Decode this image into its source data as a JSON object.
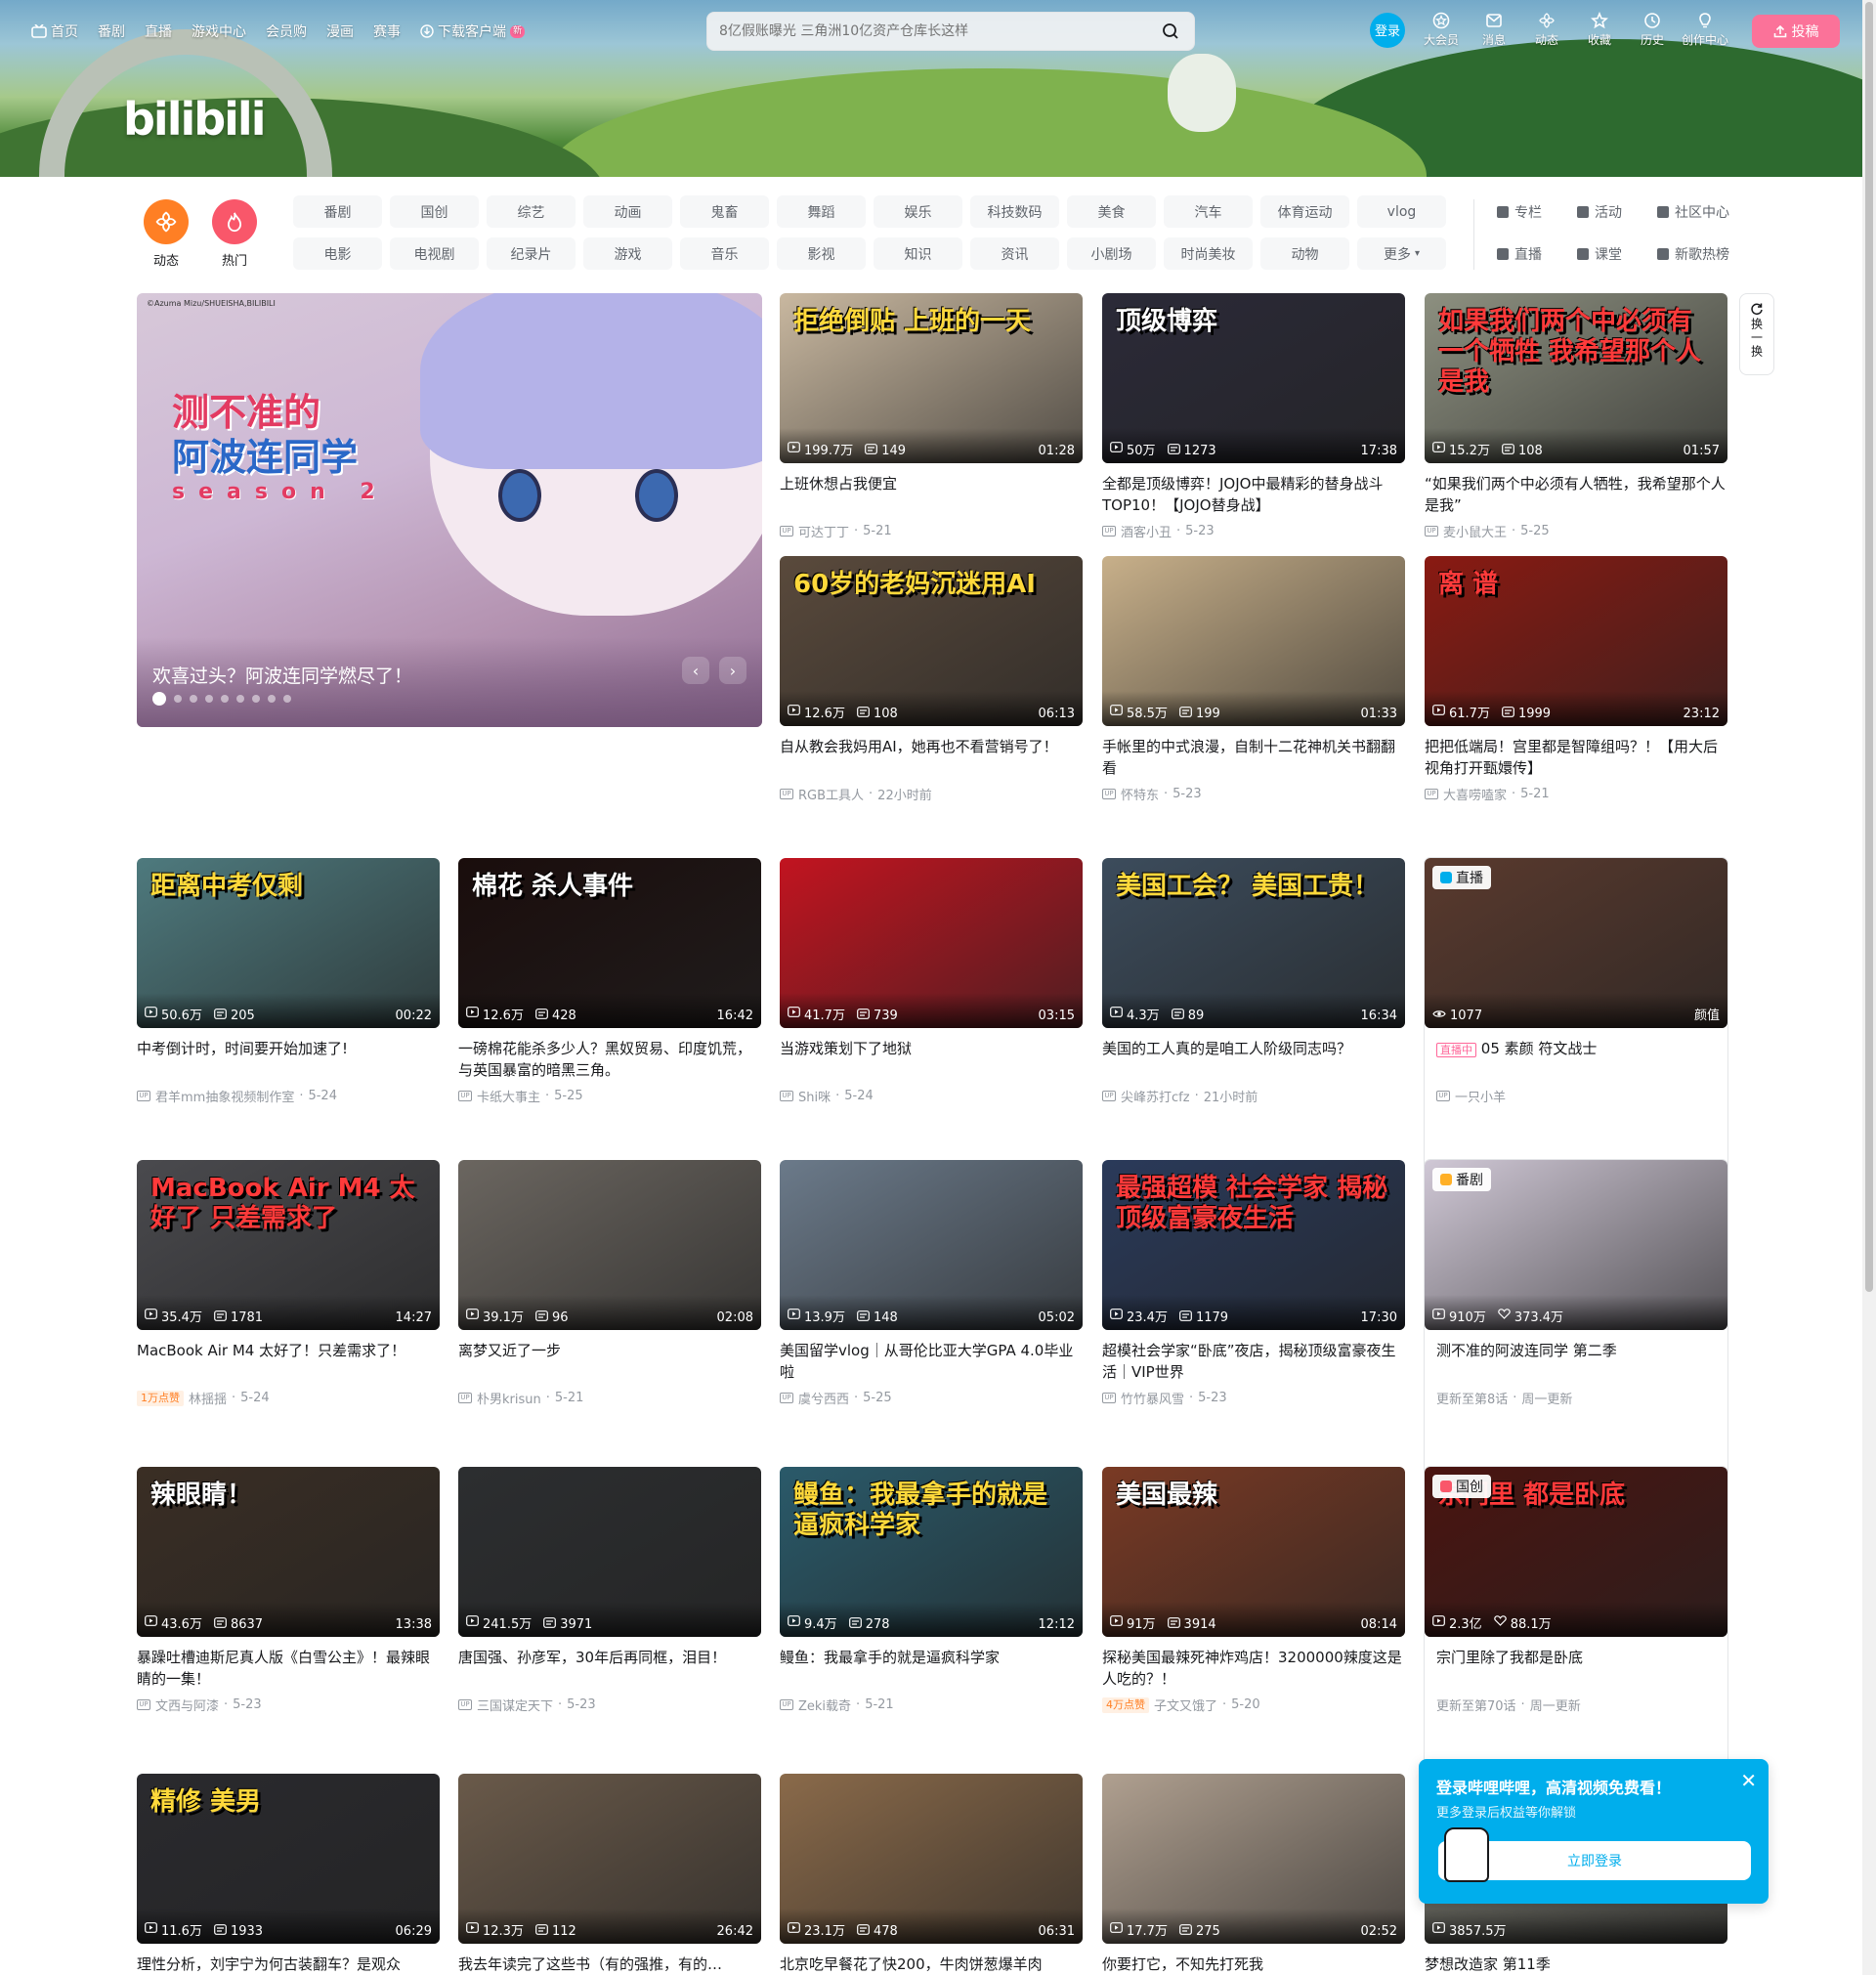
{
  "header": {
    "logo_text": "bilibili",
    "nav": [
      {
        "label": "首页",
        "icon": "tv-icon"
      },
      {
        "label": "番剧"
      },
      {
        "label": "直播"
      },
      {
        "label": "游戏中心"
      },
      {
        "label": "会员购"
      },
      {
        "label": "漫画"
      },
      {
        "label": "赛事"
      },
      {
        "label": "下载客户端",
        "icon": "download-icon",
        "badge": "新"
      }
    ],
    "search_placeholder": "8亿假账曝光 三角洲10亿资产仓库长这样",
    "login_label": "登录",
    "right_entries": [
      {
        "label": "大会员",
        "icon": "vip-icon"
      },
      {
        "label": "消息",
        "icon": "message-icon"
      },
      {
        "label": "动态",
        "icon": "dynamic-icon"
      },
      {
        "label": "收藏",
        "icon": "favorite-icon"
      },
      {
        "label": "历史",
        "icon": "history-icon"
      },
      {
        "label": "创作中心",
        "icon": "creator-icon"
      }
    ],
    "upload_label": "投稿"
  },
  "channels": {
    "big": [
      {
        "label": "动态",
        "color": "#ff7f24"
      },
      {
        "label": "热门",
        "color": "#f9576a"
      }
    ],
    "row1": [
      "番剧",
      "国创",
      "综艺",
      "动画",
      "鬼畜",
      "舞蹈",
      "娱乐",
      "科技数码",
      "美食",
      "汽车",
      "体育运动",
      "vlog"
    ],
    "row2": [
      "电影",
      "电视剧",
      "纪录片",
      "游戏",
      "音乐",
      "影视",
      "知识",
      "资讯",
      "小剧场",
      "时尚美妆",
      "动物",
      "更多"
    ],
    "side": [
      "专栏",
      "活动",
      "社区中心",
      "直播",
      "课堂",
      "新歌热榜"
    ]
  },
  "carousel": {
    "credit": "©Azuma Mizu/SHUEISHA,BILIBILI",
    "art_line1": "测不准的",
    "art_line2": "阿波连同学",
    "art_line3": "season 2",
    "caption": "欢喜过头？阿波连同学燃尽了！",
    "prev": "‹",
    "next": "›",
    "dots_total": 9,
    "dot_active": 1
  },
  "refresh_label": "换一换",
  "cards": [
    {
      "overlay": "拒绝倒贴 上班的一天",
      "views": "199.7万",
      "danmaku": "149",
      "duration": "01:28",
      "title": "上班休想占我便宜",
      "up": "可达丁丁",
      "date": "5-21",
      "bg": "#c9b8a0"
    },
    {
      "overlay": "顶级博弈",
      "views": "50万",
      "danmaku": "1273",
      "duration": "17:38",
      "title": "全都是顶级博弈！JOJO中最精彩的替身战斗TOP10！【JOJO替身战】",
      "up": "酒客小丑",
      "date": "5-23",
      "bg": "#2b2a38"
    },
    {
      "overlay": "如果我们两个中必须有一个牺牲 我希望那个人是我",
      "views": "15.2万",
      "danmaku": "108",
      "duration": "01:57",
      "title": "“如果我们两个中必须有人牺牲，我希望那个人是我”",
      "up": "麦小鼠大王",
      "date": "5-25",
      "bg": "#8d9080"
    },
    {
      "overlay": "60岁的老妈沉迷用AI",
      "views": "12.6万",
      "danmaku": "108",
      "duration": "06:13",
      "title": "自从教会我妈用AI，她再也不看营销号了！",
      "up": "RGB工具人",
      "date": "22小时前",
      "bg": "#5a4a3c"
    },
    {
      "overlay": "",
      "views": "58.5万",
      "danmaku": "199",
      "duration": "01:33",
      "title": "手帐里的中式浪漫，自制十二花神机关书翻翻看",
      "up": "怀特东",
      "date": "5-23",
      "bg": "#c8b08a"
    },
    {
      "overlay": "离 谱",
      "views": "61.7万",
      "danmaku": "1999",
      "duration": "23:12",
      "title": "把把低端局！宫里都是智障组吗？！【用大后视角打开甄嬛传】",
      "up": "大喜唠嗑家",
      "date": "5-21",
      "bg": "#8a1a12"
    },
    {
      "overlay": "距离中考仅剩",
      "views": "50.6万",
      "danmaku": "205",
      "duration": "00:22",
      "title": "中考倒计时，时间要开始加速了!",
      "up": "君羊mm抽象视频制作室",
      "date": "5-24",
      "bg": "#4e7a7e"
    },
    {
      "overlay": "棉花 杀人事件",
      "views": "12.6万",
      "danmaku": "428",
      "duration": "16:42",
      "title": "一磅棉花能杀多少人？黑奴贸易、印度饥荒，与英国暴富的暗黑三角。",
      "up": "卡纸大事主",
      "date": "5-25",
      "bg": "#1a0d0c"
    },
    {
      "overlay": "",
      "views": "41.7万",
      "danmaku": "739",
      "duration": "03:15",
      "title": "当游戏策划下了地狱",
      "up": "Shi咪",
      "date": "5-24",
      "bg": "#c21420"
    },
    {
      "overlay": "美国工会？ 美国工贵！",
      "views": "4.3万",
      "danmaku": "89",
      "duration": "16:34",
      "title": "美国的工人真的是咱工人阶级同志吗？",
      "up": "尖峰苏打cfz",
      "date": "21小时前",
      "bg": "#3c4c5c"
    },
    {
      "overlay": "",
      "tag": "直播",
      "views": "1077",
      "area": "颜值",
      "live_badge": "直播中",
      "title": "05 素颜 符文战士",
      "up": "一只小羊",
      "bg": "#5a3a2e"
    },
    {
      "overlay": "MacBook Air M4 太好了 只差需求了",
      "views": "35.4万",
      "danmaku": "1781",
      "duration": "14:27",
      "title": "MacBook Air M4 太好了！只差需求了！",
      "like_badge": "1万点赞",
      "up": "林揺揺",
      "date": "5-24",
      "bg": "#4a4a4e"
    },
    {
      "overlay": "",
      "views": "39.1万",
      "danmaku": "96",
      "duration": "02:08",
      "title": "离梦又近了一步",
      "up": "朴男krisun",
      "date": "5-21",
      "bg": "#6b6660"
    },
    {
      "overlay": "",
      "views": "13.9万",
      "danmaku": "148",
      "duration": "05:02",
      "title": "美国留学vlog｜从哥伦比亚大学GPA 4.0毕业啦",
      "up": "虞兮西西",
      "date": "5-25",
      "bg": "#6b7a8a"
    },
    {
      "overlay": "最强超模 社会学家 揭秘顶级富豪夜生活",
      "views": "23.4万",
      "danmaku": "1179",
      "duration": "17:30",
      "title": "超模社会学家“卧底”夜店，揭秘顶级富豪夜生活｜VIP世界",
      "up": "竹竹暴风雪",
      "date": "5-23",
      "bg": "#2a3a5a"
    },
    {
      "overlay": "",
      "tag": "番剧",
      "views": "910万",
      "likes": "373.4万",
      "title": "测不准的阿波连同学 第二季",
      "update": "更新至第8话",
      "update_day": "周一更新",
      "bg": "#d0c8d6"
    },
    {
      "overlay": "辣眼睛！",
      "views": "43.6万",
      "danmaku": "8637",
      "duration": "13:38",
      "title": "暴躁吐槽迪斯尼真人版《白雪公主》！最辣眼睛的一集！",
      "up": "文西与阿漆",
      "date": "5-23",
      "bg": "#3a2e24"
    },
    {
      "overlay": "",
      "views": "241.5万",
      "danmaku": "3971",
      "duration": "",
      "title": "唐国强、孙彦军，30年后再同框，泪目！",
      "up": "三国谋定天下",
      "date": "5-23",
      "bg": "#2c2e30"
    },
    {
      "overlay": "鳗鱼：我最拿手的就是逼疯科学家",
      "views": "9.4万",
      "danmaku": "278",
      "duration": "12:12",
      "title": "鳗鱼：我最拿手的就是逼疯科学家",
      "up": "Zeki载奇",
      "date": "5-21",
      "bg": "#2a5a6a"
    },
    {
      "overlay": "美国最辣",
      "views": "91万",
      "danmaku": "3914",
      "duration": "08:14",
      "title": "探秘美国最辣死神炸鸡店！3200000辣度这是人吃的？！",
      "like_badge": "4万点赞",
      "up": "子文又饿了",
      "date": "5-20",
      "bg": "#7a3a24"
    },
    {
      "overlay": "宗门里 都是卧底",
      "tag": "国创",
      "views": "2.3亿",
      "likes": "88.1万",
      "title": "宗门里除了我都是卧底",
      "update": "更新至第70话",
      "update_day": "周一更新",
      "bg": "#4a1410"
    },
    {
      "overlay": "精修 美男",
      "views": "11.6万",
      "danmaku": "1933",
      "duration": "06:29",
      "title": "理性分析，刘宇宁为何古装翻车？是观众",
      "up": "",
      "date": "",
      "bg": "#2a2a2e"
    },
    {
      "overlay": "",
      "views": "12.3万",
      "danmaku": "112",
      "duration": "26:42",
      "title": "我去年读完了这些书（有的强推，有的…",
      "up": "",
      "date": "",
      "bg": "#6a5a4a"
    },
    {
      "overlay": "",
      "views": "23.1万",
      "danmaku": "478",
      "duration": "06:31",
      "title": "北京吃早餐花了快200，牛肉饼葱爆羊肉",
      "up": "",
      "date": "",
      "bg": "#8a6a4a"
    },
    {
      "overlay": "",
      "views": "17.7万",
      "danmaku": "275",
      "duration": "02:52",
      "title": "你要打它，不知先打死我",
      "up": "",
      "date": "",
      "bg": "#b0a090"
    },
    {
      "overlay": "",
      "views": "3857.5万",
      "danmaku": "",
      "duration": "",
      "title": "梦想改造家 第11季",
      "up": "",
      "date": "",
      "bg": "#7a7a70"
    }
  ],
  "login_popup": {
    "title": "登录哔哩哔哩，高清视频免费看！",
    "subtitle": "更多登录后权益等你解锁",
    "button": "立即登录",
    "close": "✕"
  }
}
